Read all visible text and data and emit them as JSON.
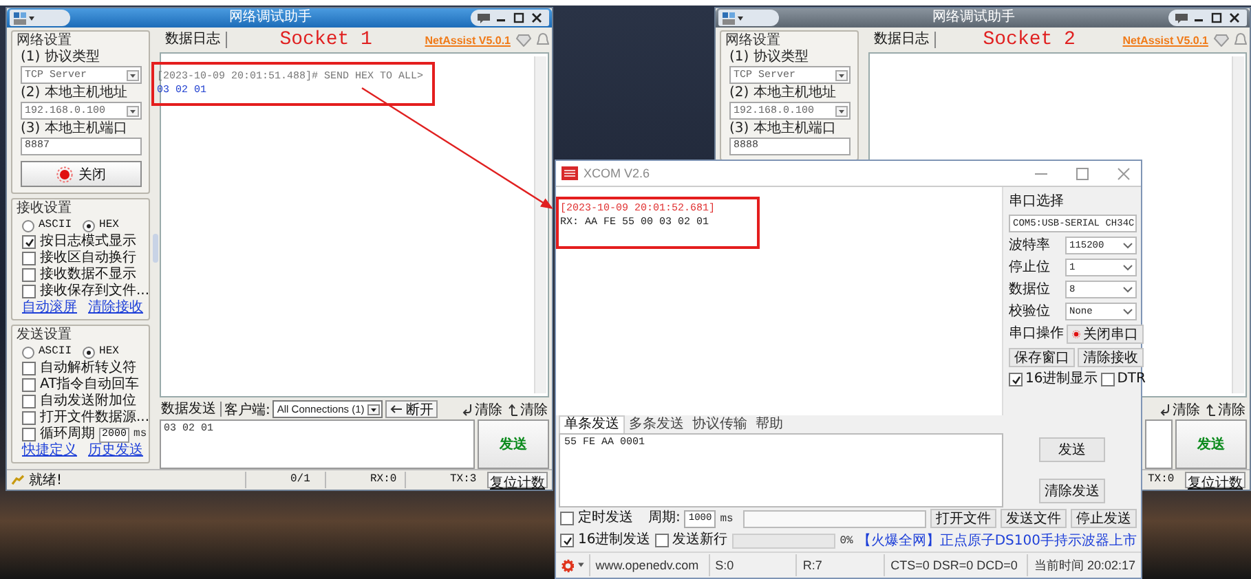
{
  "netassist_windows": [
    {
      "title": "网络调试助手",
      "active": true,
      "caption": "Socket 1",
      "version": "NetAssist V5.0.1",
      "net_settings": {
        "heading": "网络设置",
        "fields": [
          {
            "label": "(1) 协议类型",
            "value": "TCP Server",
            "kind": "select"
          },
          {
            "label": "(2) 本地主机地址",
            "value": "192.168.0.100",
            "kind": "select"
          },
          {
            "label": "(3) 本地主机端口",
            "value": "8887",
            "kind": "input"
          }
        ],
        "button": "关闭"
      },
      "receive_settings": {
        "heading": "接收设置",
        "modes": [
          {
            "label": "ASCII",
            "selected": false
          },
          {
            "label": "HEX",
            "selected": true
          }
        ],
        "options": [
          {
            "label": "按日志模式显示",
            "checked": true
          },
          {
            "label": "接收区自动换行",
            "checked": false
          },
          {
            "label": "接收数据不显示",
            "checked": false
          },
          {
            "label": "接收保存到文件...",
            "checked": false
          }
        ],
        "links": [
          "自动滚屏",
          "清除接收"
        ]
      },
      "send_settings": {
        "heading": "发送设置",
        "modes": [
          {
            "label": "ASCII",
            "selected": false
          },
          {
            "label": "HEX",
            "selected": true
          }
        ],
        "options": [
          {
            "label": "自动解析转义符",
            "checked": false
          },
          {
            "label": "AT指令自动回车",
            "checked": false
          },
          {
            "label": "自动发送附加位",
            "checked": false
          },
          {
            "label": "打开文件数据源...",
            "checked": false
          },
          {
            "label": "循环周期",
            "checked": false,
            "period": "2000",
            "unit": "ms"
          }
        ],
        "links": [
          "快捷定义",
          "历史发送"
        ]
      },
      "log_tab": "数据日志",
      "log": [
        {
          "text": "[2023-10-09 20:01:51.488]# SEND HEX TO ALL>",
          "kind": "header"
        },
        {
          "text": "03 02 01",
          "kind": "data"
        }
      ],
      "send_bar": {
        "tab": "数据发送",
        "client_label": "客户端:",
        "client": "All Connections (1)",
        "disconnect": "断开",
        "clears": [
          "清除",
          "清除"
        ]
      },
      "send_text": "03 02 01",
      "send_button": "发送",
      "status": {
        "message": "就绪!",
        "cells": [
          "0/1",
          "RX:0",
          "TX:3"
        ],
        "reset": "复位计数"
      }
    },
    {
      "title": "网络调试助手",
      "active": false,
      "caption": "Socket 2",
      "version": "NetAssist V5.0.1",
      "net_settings": {
        "heading": "网络设置",
        "fields": [
          {
            "label": "(1) 协议类型",
            "value": "TCP Server",
            "kind": "select"
          },
          {
            "label": "(2) 本地主机地址",
            "value": "192.168.0.100",
            "kind": "select"
          },
          {
            "label": "(3) 本地主机端口",
            "value": "8888",
            "kind": "input"
          }
        ]
      },
      "log_tab": "数据日志",
      "send_bar": {
        "clears": [
          "清除",
          "清除"
        ]
      },
      "send_button": "发送",
      "status": {
        "cells": [
          "TX:0"
        ],
        "reset": "复位计数"
      }
    }
  ],
  "xcom": {
    "title": "XCOM V2.6",
    "receive": [
      {
        "text": "[2023-10-09 20:01:52.681]",
        "kind": "time"
      },
      {
        "text": "RX: AA FE 55 00 03 02 01",
        "kind": "data"
      }
    ],
    "port_settings": [
      {
        "label": "串口选择",
        "value": "COM5:USB-SERIAL CH34C",
        "kind": "wide"
      },
      {
        "label": "波特率",
        "value": "115200",
        "kind": "row"
      },
      {
        "label": "停止位",
        "value": "1",
        "kind": "row"
      },
      {
        "label": "数据位",
        "value": "8",
        "kind": "row"
      },
      {
        "label": "校验位",
        "value": "None",
        "kind": "row"
      }
    ],
    "port_op": {
      "label": "串口操作",
      "button": "关闭串口"
    },
    "window_buttons": [
      "保存窗口",
      "清除接收"
    ],
    "display_options": [
      {
        "label": "16进制显示",
        "checked": true
      },
      {
        "label": "DTR",
        "checked": false
      }
    ],
    "tabs": [
      {
        "label": "单条发送",
        "selected": true
      },
      {
        "label": "多条发送",
        "selected": false
      },
      {
        "label": "协议传输",
        "selected": false
      },
      {
        "label": "帮助",
        "selected": false
      }
    ],
    "send_text": "55 FE AA 0001",
    "send_buttons": [
      "发送",
      "清除发送"
    ],
    "timer": {
      "label": "定时发送",
      "checked": false,
      "period_label": "周期:",
      "period": "1000",
      "unit": "ms"
    },
    "file_buttons": [
      "打开文件",
      "发送文件",
      "停止发送"
    ],
    "send_options": [
      {
        "label": "16进制发送",
        "checked": true
      },
      {
        "label": "发送新行",
        "checked": false
      }
    ],
    "progress": {
      "level": 0,
      "reading": "0%"
    },
    "promo": "【火爆全网】正点原子DS100手持示波器上市",
    "status": [
      "www.openedv.com",
      "S:0",
      "R:7",
      "CTS=0 DSR=0 DCD=0",
      "当前时间 20:02:17"
    ]
  }
}
